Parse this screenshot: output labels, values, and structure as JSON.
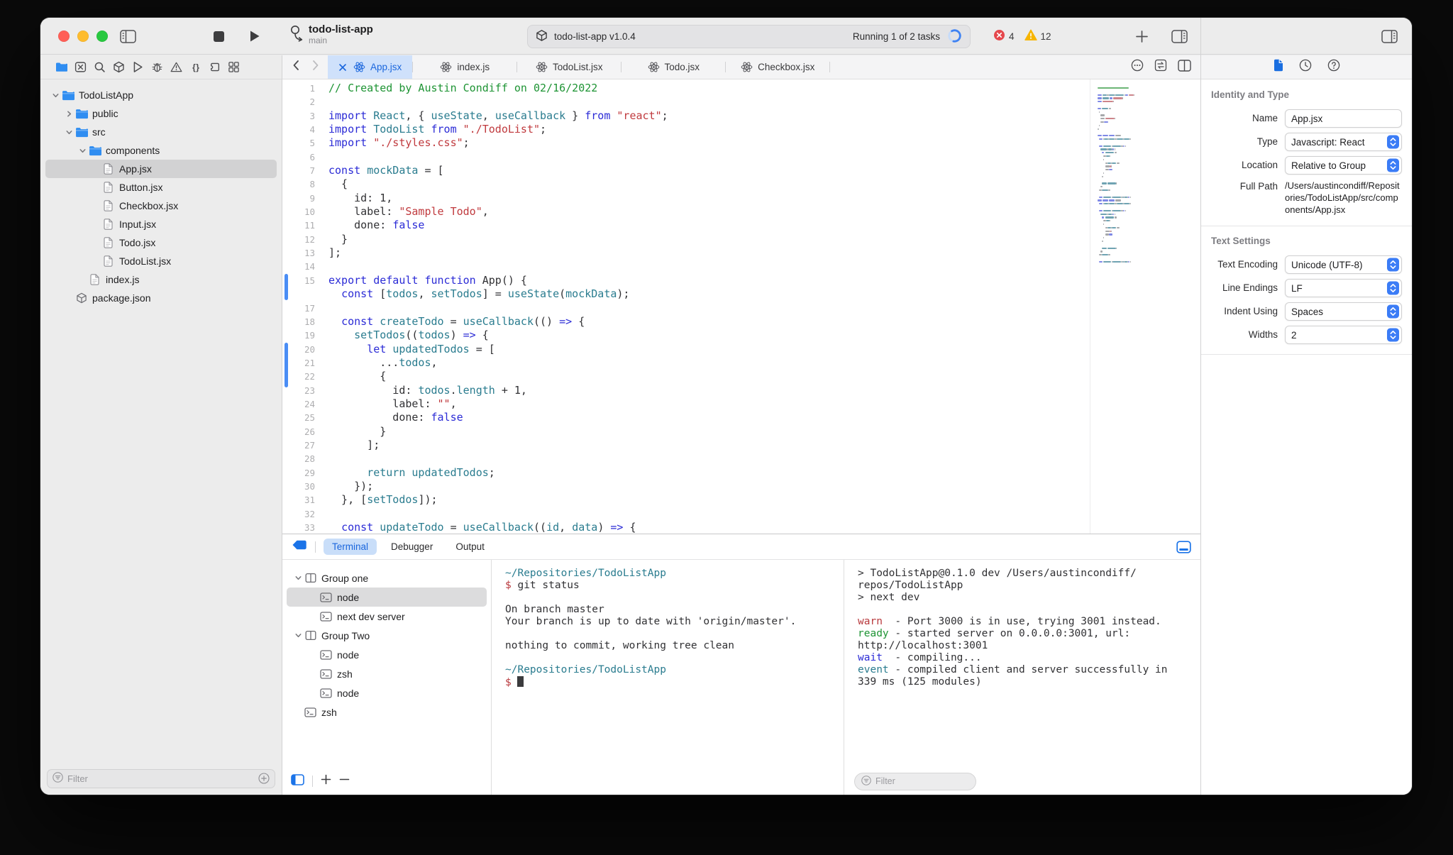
{
  "chrome": {
    "project_name": "todo-list-app",
    "branch": "main",
    "status_left": "todo-list-app v1.0.4",
    "status_right": "Running 1 of 2 tasks",
    "error_count": "4",
    "warning_count": "12"
  },
  "nav": {
    "filter_placeholder": "Filter",
    "tree": [
      {
        "label": "TodoListApp",
        "level": 0,
        "icon": "folder",
        "chev": "open"
      },
      {
        "label": "public",
        "level": 1,
        "icon": "folder",
        "chev": "closed"
      },
      {
        "label": "src",
        "level": 1,
        "icon": "folder",
        "chev": "open"
      },
      {
        "label": "components",
        "level": 2,
        "icon": "folder",
        "chev": "open"
      },
      {
        "label": "App.jsx",
        "level": 3,
        "icon": "file",
        "selected": true
      },
      {
        "label": "Button.jsx",
        "level": 3,
        "icon": "file"
      },
      {
        "label": "Checkbox.jsx",
        "level": 3,
        "icon": "file"
      },
      {
        "label": "Input.jsx",
        "level": 3,
        "icon": "file"
      },
      {
        "label": "Todo.jsx",
        "level": 3,
        "icon": "file"
      },
      {
        "label": "TodoList.jsx",
        "level": 3,
        "icon": "file"
      },
      {
        "label": "index.js",
        "level": 2,
        "icon": "file"
      },
      {
        "label": "package.json",
        "level": 1,
        "icon": "package"
      }
    ]
  },
  "tabs": [
    {
      "label": "App.jsx",
      "active": true
    },
    {
      "label": "index.js"
    },
    {
      "label": "TodoList.jsx"
    },
    {
      "label": "Todo.jsx"
    },
    {
      "label": "Checkbox.jsx"
    }
  ],
  "editor": {
    "change_bars": [
      {
        "from": 15,
        "lines": 1.9
      },
      {
        "from": 20,
        "lines": 3.3
      }
    ],
    "lines": [
      {
        "n": "1",
        "seg": [
          [
            "c",
            "// Created by Austin Condiff on 02/16/2022"
          ]
        ]
      },
      {
        "n": "2",
        "seg": []
      },
      {
        "n": "3",
        "seg": [
          [
            "k",
            "import"
          ],
          [
            "p",
            " "
          ],
          [
            "t",
            "React"
          ],
          [
            "p",
            ", { "
          ],
          [
            "t",
            "useState"
          ],
          [
            "p",
            ", "
          ],
          [
            "t",
            "useCallback"
          ],
          [
            "p",
            " } "
          ],
          [
            "k",
            "from"
          ],
          [
            "p",
            " "
          ],
          [
            "s",
            "\"react\""
          ],
          [
            "p",
            ";"
          ]
        ]
      },
      {
        "n": "4",
        "seg": [
          [
            "k",
            "import"
          ],
          [
            "p",
            " "
          ],
          [
            "t",
            "TodoList"
          ],
          [
            "p",
            " "
          ],
          [
            "k",
            "from"
          ],
          [
            "p",
            " "
          ],
          [
            "s",
            "\"./TodoList\""
          ],
          [
            "p",
            ";"
          ]
        ]
      },
      {
        "n": "5",
        "seg": [
          [
            "k",
            "import"
          ],
          [
            "p",
            " "
          ],
          [
            "s",
            "\"./styles.css\""
          ],
          [
            "p",
            ";"
          ]
        ]
      },
      {
        "n": "6",
        "seg": []
      },
      {
        "n": "7",
        "seg": [
          [
            "k",
            "const"
          ],
          [
            "p",
            " "
          ],
          [
            "t",
            "mockData"
          ],
          [
            "p",
            " = ["
          ]
        ]
      },
      {
        "n": "8",
        "seg": [
          [
            "p",
            "  {"
          ]
        ]
      },
      {
        "n": "9",
        "seg": [
          [
            "p",
            "    id: 1,"
          ]
        ]
      },
      {
        "n": "10",
        "seg": [
          [
            "p",
            "    label: "
          ],
          [
            "s",
            "\"Sample Todo\""
          ],
          [
            "p",
            ","
          ]
        ]
      },
      {
        "n": "11",
        "seg": [
          [
            "p",
            "    done: "
          ],
          [
            "k",
            "false"
          ]
        ]
      },
      {
        "n": "12",
        "seg": [
          [
            "p",
            "  }"
          ]
        ]
      },
      {
        "n": "13",
        "seg": [
          [
            "p",
            "];"
          ]
        ]
      },
      {
        "n": "14",
        "seg": []
      },
      {
        "n": "15",
        "seg": [
          [
            "k",
            "export"
          ],
          [
            "p",
            " "
          ],
          [
            "k",
            "default"
          ],
          [
            "p",
            " "
          ],
          [
            "k",
            "function"
          ],
          [
            "p",
            " "
          ],
          [
            "p",
            "App() {"
          ]
        ]
      },
      {
        "n": "",
        "seg": [
          [
            "p",
            "  "
          ],
          [
            "k",
            "const"
          ],
          [
            "p",
            " ["
          ],
          [
            "t",
            "todos"
          ],
          [
            "p",
            ", "
          ],
          [
            "t",
            "setTodos"
          ],
          [
            "p",
            "] = "
          ],
          [
            "t",
            "useState"
          ],
          [
            "p",
            "("
          ],
          [
            "t",
            "mockData"
          ],
          [
            "p",
            ");"
          ]
        ]
      },
      {
        "n": "17",
        "seg": []
      },
      {
        "n": "18",
        "seg": [
          [
            "p",
            "  "
          ],
          [
            "k",
            "const"
          ],
          [
            "p",
            " "
          ],
          [
            "t",
            "createTodo"
          ],
          [
            "p",
            " = "
          ],
          [
            "t",
            "useCallback"
          ],
          [
            "p",
            "(() "
          ],
          [
            "k",
            "=>"
          ],
          [
            "p",
            " {"
          ]
        ]
      },
      {
        "n": "19",
        "seg": [
          [
            "p",
            "    "
          ],
          [
            "t",
            "setTodos"
          ],
          [
            "p",
            "(("
          ],
          [
            "t",
            "todos"
          ],
          [
            "p",
            ") "
          ],
          [
            "k",
            "=>"
          ],
          [
            "p",
            " {"
          ]
        ]
      },
      {
        "n": "20",
        "seg": [
          [
            "p",
            "      "
          ],
          [
            "k",
            "let"
          ],
          [
            "p",
            " "
          ],
          [
            "t",
            "updatedTodos"
          ],
          [
            "p",
            " = ["
          ]
        ]
      },
      {
        "n": "21",
        "seg": [
          [
            "p",
            "        ..."
          ],
          [
            "t",
            "todos"
          ],
          [
            "p",
            ","
          ]
        ]
      },
      {
        "n": "22",
        "seg": [
          [
            "p",
            "        {"
          ]
        ]
      },
      {
        "n": "23",
        "seg": [
          [
            "p",
            "          id: "
          ],
          [
            "t",
            "todos"
          ],
          [
            "p",
            "."
          ],
          [
            "t",
            "length"
          ],
          [
            "p",
            " + 1,"
          ]
        ]
      },
      {
        "n": "24",
        "seg": [
          [
            "p",
            "          label: "
          ],
          [
            "s",
            "\"\""
          ],
          [
            "p",
            ","
          ]
        ]
      },
      {
        "n": "25",
        "seg": [
          [
            "p",
            "          done: "
          ],
          [
            "k",
            "false"
          ]
        ]
      },
      {
        "n": "26",
        "seg": [
          [
            "p",
            "        }"
          ]
        ]
      },
      {
        "n": "27",
        "seg": [
          [
            "p",
            "      ];"
          ]
        ]
      },
      {
        "n": "28",
        "seg": []
      },
      {
        "n": "29",
        "seg": [
          [
            "p",
            "      "
          ],
          [
            "t",
            "return"
          ],
          [
            "p",
            " "
          ],
          [
            "t",
            "updatedTodos"
          ],
          [
            "p",
            ";"
          ]
        ]
      },
      {
        "n": "30",
        "seg": [
          [
            "p",
            "    });"
          ]
        ]
      },
      {
        "n": "31",
        "seg": [
          [
            "p",
            "  }, ["
          ],
          [
            "t",
            "setTodos"
          ],
          [
            "p",
            "]);"
          ]
        ]
      },
      {
        "n": "32",
        "seg": []
      },
      {
        "n": "33",
        "seg": [
          [
            "p",
            "  "
          ],
          [
            "k",
            "const"
          ],
          [
            "p",
            " "
          ],
          [
            "t",
            "updateTodo"
          ],
          [
            "p",
            " = "
          ],
          [
            "t",
            "useCallback"
          ],
          [
            "p",
            "(("
          ],
          [
            "t",
            "id"
          ],
          [
            "p",
            ", "
          ],
          [
            "t",
            "data"
          ],
          [
            "p",
            ") "
          ],
          [
            "k",
            "=>"
          ],
          [
            "p",
            " {"
          ]
        ]
      }
    ]
  },
  "inspector": {
    "identity": {
      "title": "Identity and Type",
      "rows": [
        {
          "label": "Name",
          "control": "input",
          "value": "App.jsx"
        },
        {
          "label": "Type",
          "control": "select",
          "value": "Javascript: React"
        },
        {
          "label": "Location",
          "control": "select",
          "value": "Relative to Group"
        },
        {
          "label": "Full Path",
          "control": "text",
          "value": "/Users/austincondiff/Repositories/TodoListApp/src/components/App.jsx"
        }
      ]
    },
    "text_settings": {
      "title": "Text Settings",
      "rows": [
        {
          "label": "Text Encoding",
          "control": "select",
          "value": "Unicode (UTF-8)"
        },
        {
          "label": "Line Endings",
          "control": "select",
          "value": "LF"
        },
        {
          "label": "Indent Using",
          "control": "select",
          "value": "Spaces"
        },
        {
          "label": "Widths",
          "control": "select",
          "value": "2"
        }
      ]
    }
  },
  "panel": {
    "tabs": [
      {
        "label": "Terminal",
        "active": true
      },
      {
        "label": "Debugger"
      },
      {
        "label": "Output"
      }
    ],
    "filter_placeholder": "Filter",
    "tree": [
      {
        "label": "Group one",
        "level": 0,
        "icon": "group",
        "chev": "open"
      },
      {
        "label": "node",
        "level": 1,
        "icon": "shell",
        "selected": true
      },
      {
        "label": "next dev server",
        "level": 1,
        "icon": "shell"
      },
      {
        "label": "Group Two",
        "level": 0,
        "icon": "group",
        "chev": "open"
      },
      {
        "label": "node",
        "level": 1,
        "icon": "shell"
      },
      {
        "label": "zsh",
        "level": 1,
        "icon": "shell"
      },
      {
        "label": "node",
        "level": 1,
        "icon": "shell"
      },
      {
        "label": "zsh",
        "level": 0,
        "icon": "shell"
      }
    ],
    "term1": [
      [
        [
          "pt",
          "~/Repositories/TodoListApp"
        ]
      ],
      [
        [
          "pr",
          "$"
        ],
        [
          "d",
          " git status"
        ]
      ],
      [],
      [
        [
          "d",
          "On branch master"
        ]
      ],
      [
        [
          "d",
          "Your branch is up to date with 'origin/master'."
        ]
      ],
      [],
      [
        [
          "d",
          "nothing to commit, working tree clean"
        ]
      ],
      [],
      [
        [
          "pt",
          "~/Repositories/TodoListApp"
        ]
      ],
      [
        [
          "pr",
          "$"
        ],
        [
          "d",
          " "
        ],
        [
          "cur",
          ""
        ]
      ]
    ],
    "term2": [
      [
        [
          "d",
          "> TodoListApp@0.1.0 dev /Users/austincondiff/"
        ]
      ],
      [
        [
          "d",
          "repos/TodoListApp"
        ]
      ],
      [
        [
          "d",
          "> next dev"
        ]
      ],
      [],
      [
        [
          "w",
          "warn"
        ],
        [
          "d",
          "  - Port 3000 is in use, trying 3001 instead."
        ]
      ],
      [
        [
          "g",
          "ready"
        ],
        [
          "d",
          " - started server on 0.0.0.0:3001, url:"
        ]
      ],
      [
        [
          "d",
          "http://localhost:3001"
        ]
      ],
      [
        [
          "b",
          "wait"
        ],
        [
          "d",
          "  - compiling..."
        ]
      ],
      [
        [
          "t",
          "event"
        ],
        [
          "d",
          " - compiled client and server successfully in"
        ]
      ],
      [
        [
          "d",
          "339 ms (125 modules)"
        ]
      ]
    ]
  }
}
